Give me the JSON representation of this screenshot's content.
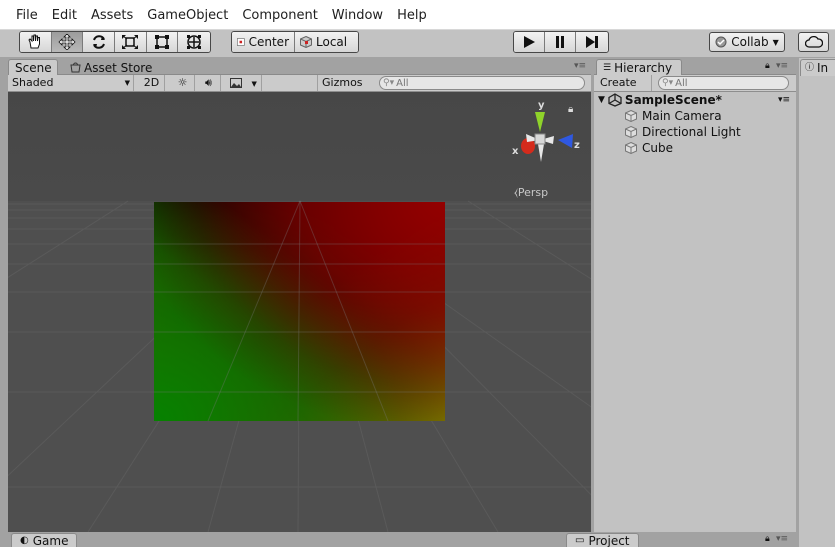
{
  "menu": {
    "items": [
      {
        "label": "File"
      },
      {
        "label": "Edit"
      },
      {
        "label": "Assets"
      },
      {
        "label": "GameObject"
      },
      {
        "label": "Component"
      },
      {
        "label": "Window"
      },
      {
        "label": "Help"
      }
    ]
  },
  "toolbar": {
    "transform_tools": [
      {
        "name": "hand-tool",
        "icon": "hand-icon",
        "active": false
      },
      {
        "name": "move-tool",
        "icon": "move-icon",
        "active": true
      },
      {
        "name": "rotate-tool",
        "icon": "rotate-icon",
        "active": false
      },
      {
        "name": "scale-tool",
        "icon": "scale-icon",
        "active": false
      },
      {
        "name": "rect-tool",
        "icon": "rect-icon",
        "active": false
      },
      {
        "name": "transform-tool",
        "icon": "transform-icon",
        "active": false
      }
    ],
    "pivot_label": "Center",
    "space_label": "Local",
    "collab_label": "Collab"
  },
  "scene_panel": {
    "tabs": [
      {
        "label": "Scene",
        "active": true
      },
      {
        "label": "Asset Store",
        "active": false
      }
    ],
    "shading_mode": "Shaded",
    "mode_2d_label": "2D",
    "gizmos_label": "Gizmos",
    "search_placeholder": "All",
    "gizmo_axes": {
      "x": "x",
      "y": "y",
      "z": "z"
    },
    "projection_label": "Persp"
  },
  "hierarchy_panel": {
    "tab_label": "Hierarchy",
    "create_label": "Create",
    "search_placeholder": "All",
    "scene_name": "SampleScene*",
    "objects": [
      {
        "label": "Main Camera"
      },
      {
        "label": "Directional Light"
      },
      {
        "label": "Cube"
      }
    ]
  },
  "inspector_panel": {
    "tab_label": "In"
  },
  "bottom_tabs": {
    "game_label": "Game",
    "project_label": "Project"
  },
  "colors": {
    "gizmo_x": "#d42b1c",
    "gizmo_y": "#8fd32a",
    "gizmo_z": "#2f58e0"
  }
}
